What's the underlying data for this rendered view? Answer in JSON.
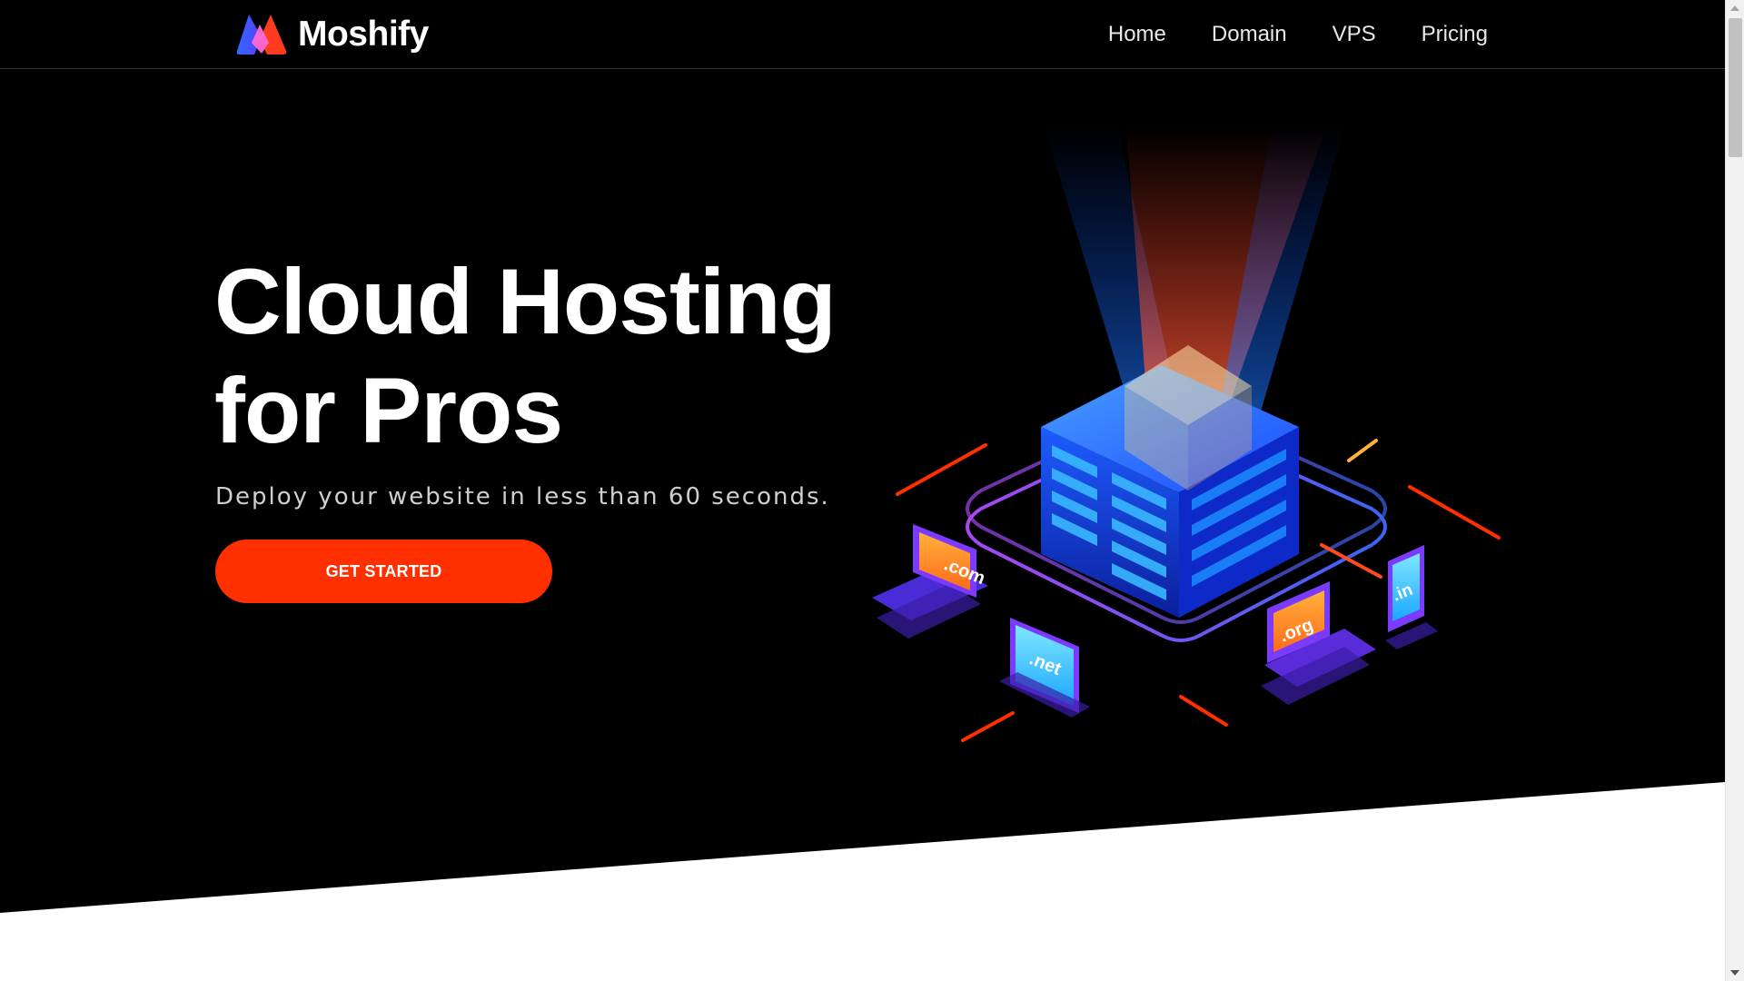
{
  "brand": {
    "name": "Moshify",
    "logo_icon": "moshify-logo-icon"
  },
  "nav": {
    "links": [
      {
        "label": "Home"
      },
      {
        "label": "Domain"
      },
      {
        "label": "VPS"
      },
      {
        "label": "Pricing"
      }
    ]
  },
  "hero": {
    "title_line1": "Cloud Hosting",
    "title_line2": "for Pros",
    "subtitle": "Deploy your website in less than 60 seconds.",
    "cta_label": "GET STARTED"
  },
  "illustration": {
    "icon": "cloud-server-illustration",
    "domain_labels": [
      ".com",
      ".net",
      ".org",
      ".in"
    ]
  },
  "colors": {
    "hero_background": "#000000",
    "accent": "#ff2f00",
    "text_light": "#ffffff",
    "subtitle_text": "#cfcfcf"
  }
}
